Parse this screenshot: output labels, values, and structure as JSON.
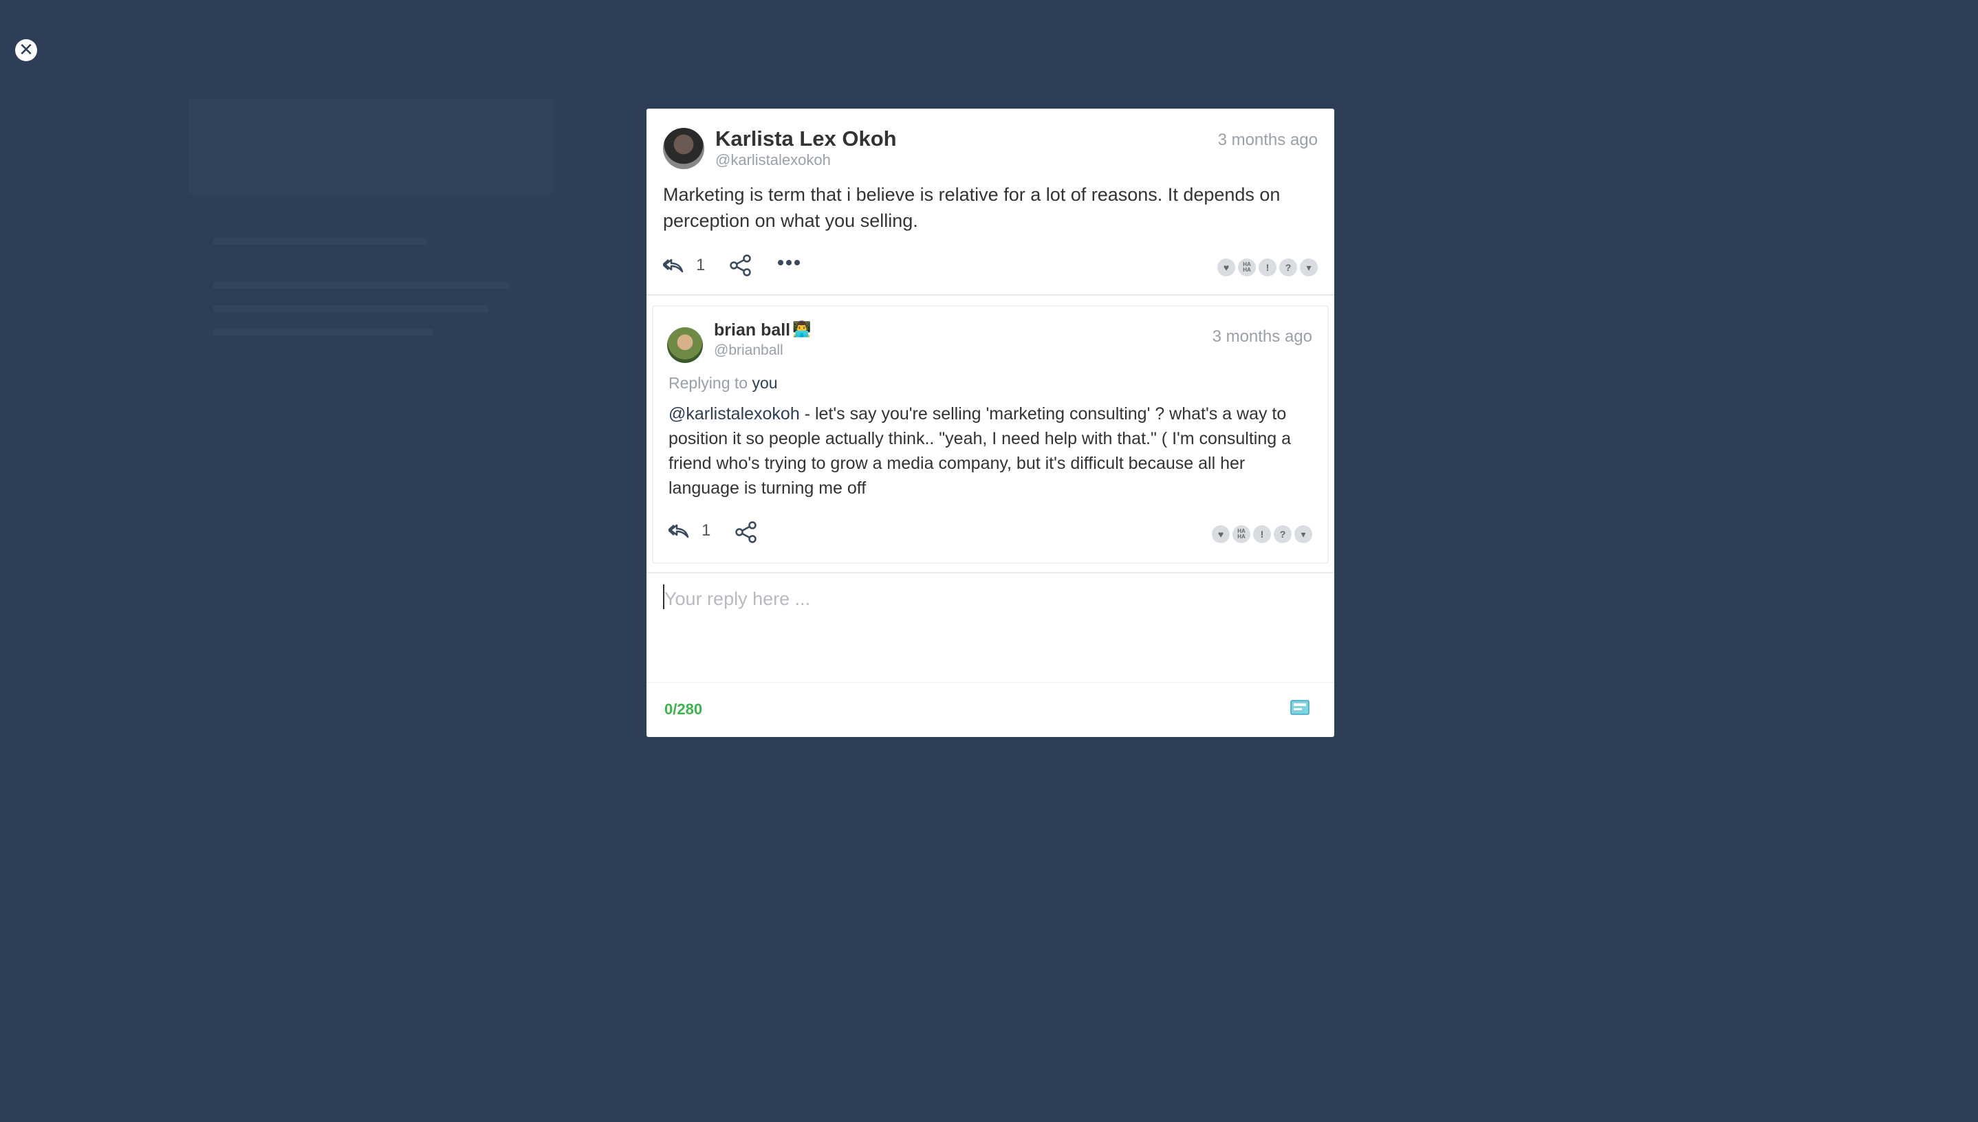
{
  "close": {
    "icon": "close-icon"
  },
  "post": {
    "author_name": "Karlista Lex Okoh",
    "author_handle": "@karlistalexokoh",
    "time": "3 months ago",
    "body": "Marketing is term that i believe is relative for a lot of reasons. It depends on perception on what you selling.",
    "reply_count": "1"
  },
  "reply": {
    "author_name": "brian ball",
    "author_handle": "@brianball",
    "time": "3 months ago",
    "replying_prefix": "Replying to",
    "replying_to": "you",
    "mention": "@karlistalexokoh",
    "body": " - let's say you're selling 'marketing consulting' ? what's a way to position it so people actually think.. \"yeah, I need help with that.\" ( I'm consulting a friend who's trying to grow a media company, but it's difficult because all her language is turning me off",
    "reply_count": "1"
  },
  "reactions": {
    "love": "",
    "haha": "HA HA",
    "wow": "!",
    "confused": "?",
    "dislike": ""
  },
  "composer": {
    "placeholder": "Your reply here ...",
    "counter": "0/280"
  },
  "colors": {
    "backdrop": "#2d3e56",
    "counter_green": "#3bb54a",
    "mention_blue": "#2d3e56"
  }
}
